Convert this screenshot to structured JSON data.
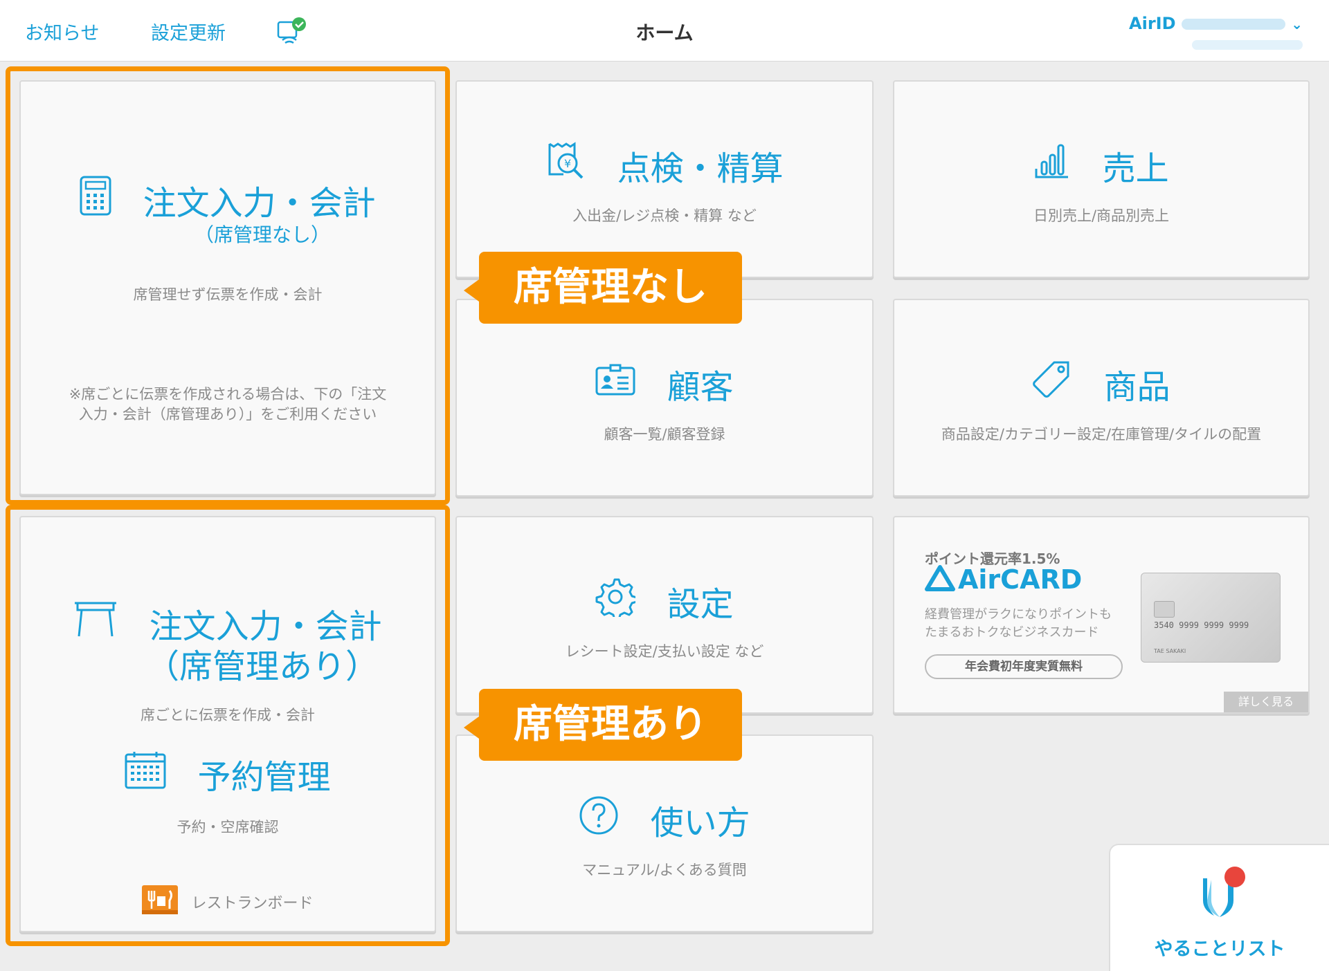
{
  "header": {
    "news": "お知らせ",
    "settings_update": "設定更新",
    "title": "ホーム",
    "airid_label": "AirID"
  },
  "tiles": {
    "order_no_table": {
      "title": "注文入力・会計",
      "subtitle": "（席管理なし）",
      "desc": "席管理せず伝票を作成・会計",
      "note_line1": "※席ごとに伝票を作成される場合は、下の「注文",
      "note_line2": "入力・会計（席管理あり）」をご利用ください"
    },
    "check": {
      "title": "点検・精算",
      "desc": "入出金/レジ点検・精算 など"
    },
    "sales": {
      "title": "売上",
      "desc": "日別売上/商品別売上"
    },
    "customer": {
      "title": "顧客",
      "desc": "顧客一覧/顧客登録"
    },
    "product": {
      "title": "商品",
      "desc": "商品設定/カテゴリー設定/在庫管理/タイルの配置"
    },
    "order_with_table": {
      "title": "注文入力・会計",
      "subtitle": "（席管理あり）",
      "desc": "席ごとに伝票を作成・会計",
      "reserve_title": "予約管理",
      "reserve_desc": "予約・空席確認",
      "restaurant_board": "レストランボード"
    },
    "settings": {
      "title": "設定",
      "desc": "レシート設定/支払い設定 など"
    },
    "howto": {
      "title": "使い方",
      "desc": "マニュアル/よくある質問"
    }
  },
  "ad": {
    "rate": "ポイント還元率1.5%",
    "logo": "AirCARD",
    "text_line1": "経費管理がラクになりポイントも",
    "text_line2": "たまるおトクなビジネスカード",
    "pill": "年会費初年度実質無料",
    "card_number": "3540 9999 9999 9999",
    "card_name": "TAE SAKAKI",
    "more": "詳しく見る"
  },
  "callouts": {
    "none": "席管理なし",
    "with": "席管理あり"
  },
  "todo": {
    "label": "やることリスト"
  },
  "colors": {
    "accent": "#1aa0d8",
    "orange": "#f79300",
    "badge_red": "#e8453c"
  }
}
